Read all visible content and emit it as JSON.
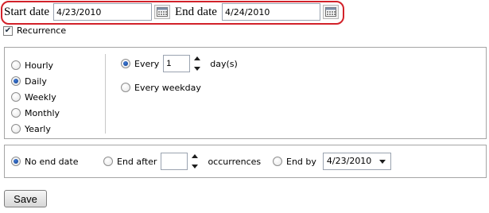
{
  "range": {
    "start_label": "Start date",
    "start_value": "4/23/2010",
    "end_label": "End date",
    "end_value": "4/24/2010"
  },
  "recurrence": {
    "label": "Recurrence",
    "checked": true,
    "patterns": [
      "Hourly",
      "Daily",
      "Weekly",
      "Monthly",
      "Yearly"
    ],
    "selected_pattern": "Daily",
    "daily": {
      "every_label": "Every",
      "every_value": "1",
      "unit_label": "day(s)",
      "weekday_label": "Every weekday",
      "selected": "every"
    }
  },
  "end": {
    "no_end_label": "No end date",
    "end_after_label": "End after",
    "end_after_value": "",
    "occurrences_label": "occurrences",
    "end_by_label": "End by",
    "end_by_value": "4/23/2010",
    "selected": "no_end"
  },
  "actions": {
    "save_label": "Save"
  },
  "icons": {
    "calendar": "calendar-icon",
    "spinner": "spinner-icon",
    "dropdown": "chevron-down-icon"
  },
  "colors": {
    "highlight_border": "#d2222a",
    "radio_selected": "#1d4f9e"
  }
}
